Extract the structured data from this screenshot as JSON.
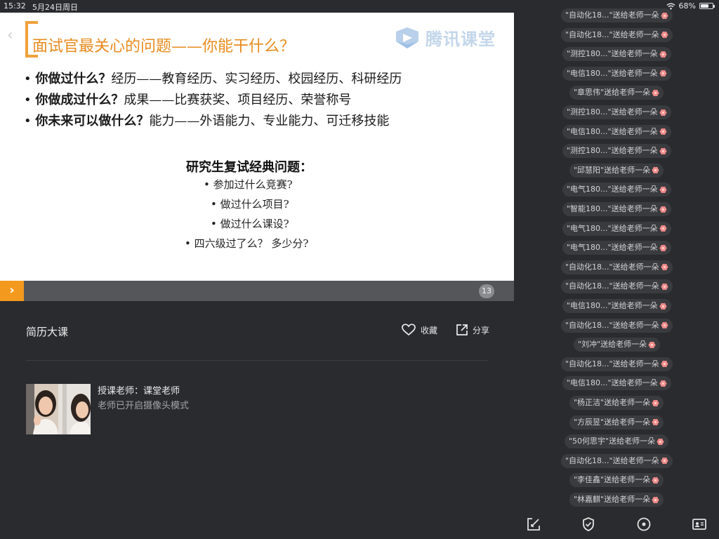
{
  "status_bar": {
    "time": "15:32",
    "date": "5月24日周日",
    "battery": "68%",
    "battery_level": 0.68
  },
  "slide": {
    "title": "面试官最关心的问题——你能干什么？",
    "logo_text": "腾讯课堂",
    "bullets": [
      {
        "q": "你做过什么？",
        "a": "经历——教育经历、实习经历、校园经历、科研经历"
      },
      {
        "q": "你做成过什么？",
        "a": "成果——比赛获奖、项目经历、荣誉称号"
      },
      {
        "q": "你未来可以做什么？",
        "a": "能力——外语能力、专业能力、可迁移技能"
      }
    ],
    "sub_title": "研究生复试经典问题：",
    "sub_items": [
      "参加过什么竞赛?",
      "做过什么项目?",
      "做过什么课设?",
      "四六级过了么？ 多少分?"
    ]
  },
  "slide_bar": {
    "page": "13"
  },
  "course": {
    "title": "简历大课",
    "favorite_label": "收藏",
    "share_label": "分享",
    "teacher_label": "授课老师：课堂老师",
    "camera_note": "老师已开启摄像头模式"
  },
  "gifts": [
    "\"自动化18...\"送给老师一朵",
    "\"自动化18...\"送给老师一朵",
    "\"测控180...\"送给老师一朵",
    "\"电信180...\"送给老师一朵",
    "\"章思伟\"送给老师一朵",
    "\"测控180...\"送给老师一朵",
    "\"电信180...\"送给老师一朵",
    "\"测控180...\"送给老师一朵",
    "\"邱慧阳\"送给老师一朵",
    "\"电气180...\"送给老师一朵",
    "\"智能180...\"送给老师一朵",
    "\"电气180...\"送给老师一朵",
    "\"电气180...\"送给老师一朵",
    "\"自动化18...\"送给老师一朵",
    "\"自动化18...\"送给老师一朵",
    "\"电信180...\"送给老师一朵",
    "\"自动化18...\"送给老师一朵",
    "\"刘冲\"送给老师一朵",
    "\"自动化18...\"送给老师一朵",
    "\"电信180...\"送给老师一朵",
    "\"杨正洁\"送给老师一朵",
    "\"方辰昱\"送给老师一朵",
    "\"50何思宇\"送给老师一朵",
    "\"自动化18...\"送给老师一朵",
    "\"李佳鑫\"送给老师一朵",
    "\"林嘉麒\"送给老师一朵"
  ],
  "colors": {
    "accent": "#f39a1e",
    "background": "#2a2b2f",
    "flower": "#f08a8a"
  }
}
